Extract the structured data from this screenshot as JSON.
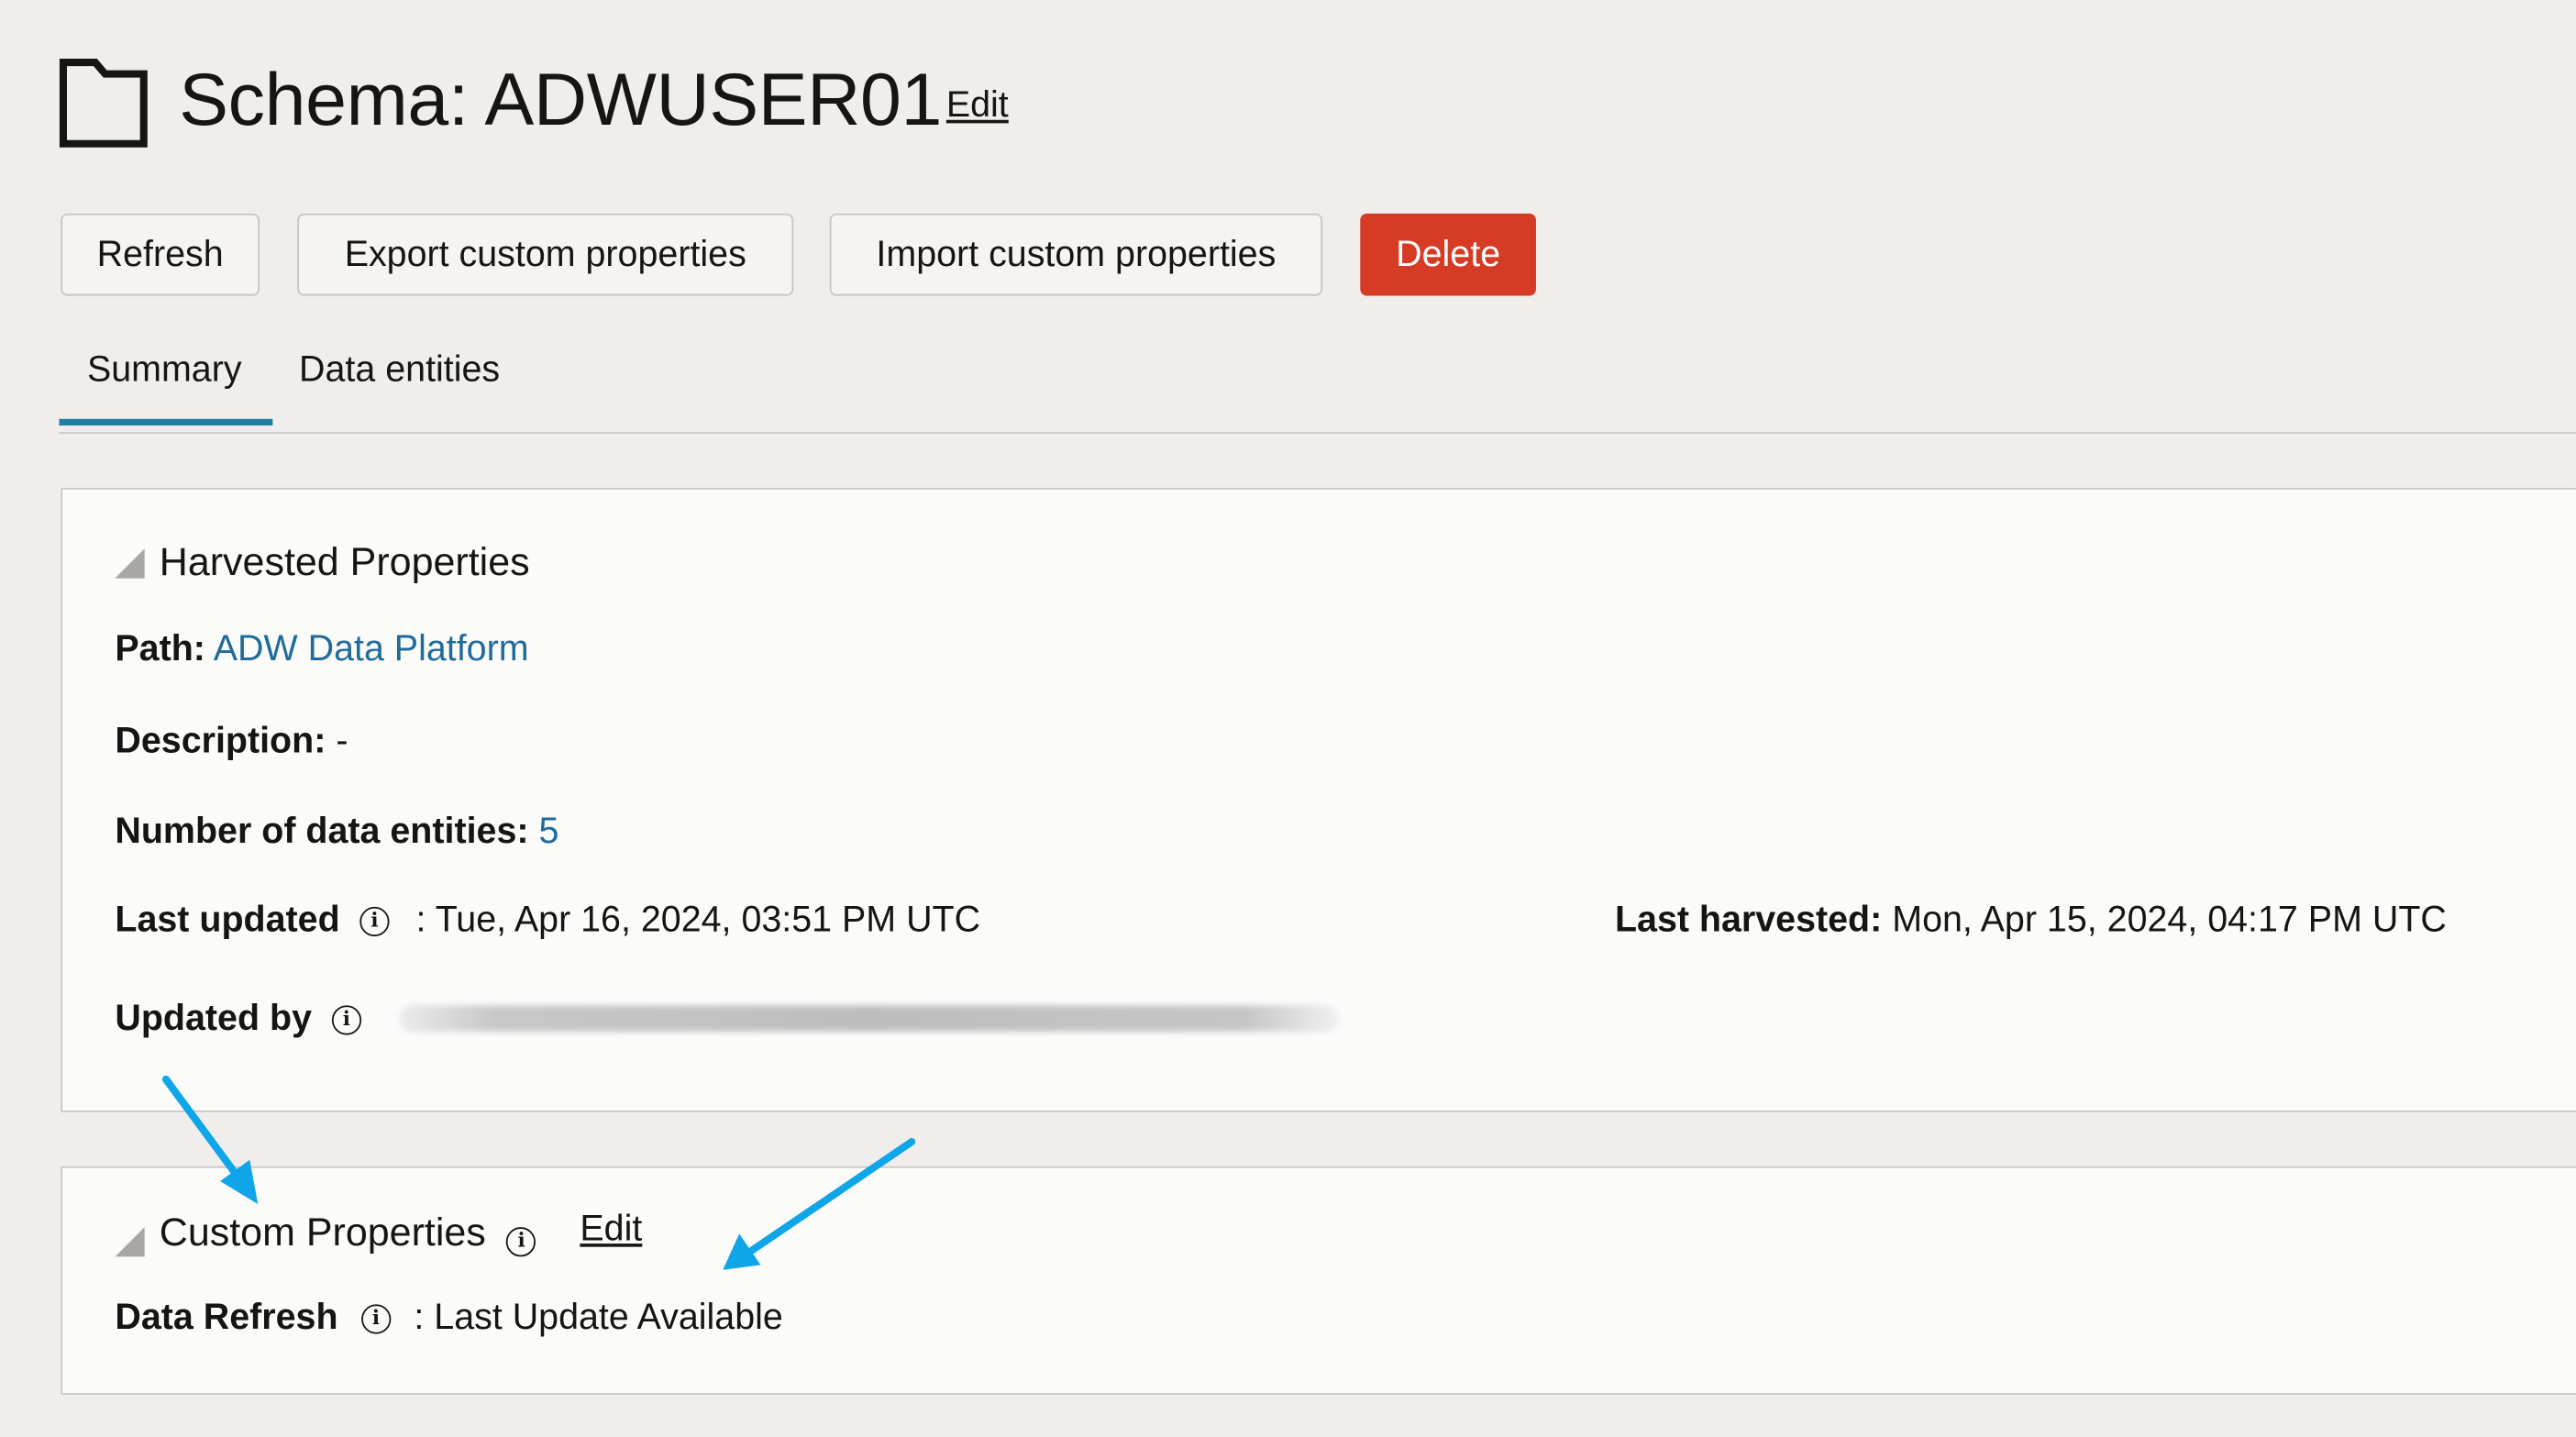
{
  "header": {
    "title": "Schema: ADWUSER01",
    "edit_label": "Edit"
  },
  "toolbar": {
    "refresh_label": "Refresh",
    "export_label": "Export custom properties",
    "import_label": "Import custom properties",
    "delete_label": "Delete"
  },
  "tabs": [
    {
      "label": "Summary",
      "active": true
    },
    {
      "label": "Data entities",
      "active": false
    }
  ],
  "harvested": {
    "title": "Harvested Properties",
    "path_label": "Path:",
    "path_value": "ADW Data Platform",
    "description_label": "Description:",
    "description_value": "-",
    "entities_label": "Number of data entities:",
    "entities_value": "5",
    "last_updated_label": "Last updated",
    "last_updated_value": ": Tue, Apr 16, 2024, 03:51 PM UTC",
    "last_harvested_label": "Last harvested:",
    "last_harvested_value": "Mon, Apr 15, 2024, 04:17 PM UTC",
    "updated_by_label": "Updated by"
  },
  "custom": {
    "title": "Custom Properties",
    "edit_label": "Edit",
    "data_refresh_label": "Data Refresh",
    "data_refresh_value": ": Last Update Available"
  },
  "icons": {
    "info": "i"
  },
  "colors": {
    "accent": "#227e9e",
    "link": "#1f6b9b",
    "delete": "#d63b25",
    "annotation_arrow": "#0ea5e9"
  }
}
